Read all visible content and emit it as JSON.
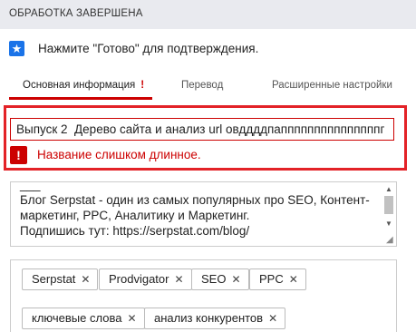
{
  "header": {
    "title": "ОБРАБОТКА ЗАВЕРШЕНА"
  },
  "notice": {
    "icon": "star-icon",
    "text": "Нажмите \"Готово\" для подтверждения."
  },
  "tabs": [
    {
      "label": "Основная информация",
      "badge": "!"
    },
    {
      "label": "Перевод"
    },
    {
      "label": "Расширенные настройки"
    }
  ],
  "title_field": {
    "value": "Выпуск 2  Дерево сайта и анализ url овддддпапппппппппппппппг"
  },
  "error": {
    "icon": "!",
    "message": "Название слишком длинное."
  },
  "description": {
    "text": "___\nБлог Serpstat - один из самых популярных про SEO, Контент-маркетинг, PPC, Аналитику и Маркетинг.\nПодпишись тут: https://serpstat.com/blog/"
  },
  "tags": [
    "Serpstat",
    "Prodvigator",
    "SEO",
    "PPC",
    "ключевые слова",
    "анализ конкурентов"
  ],
  "colors": {
    "accent_red": "#cc0000",
    "highlight_red": "#e32227",
    "star_blue": "#1a73e8"
  }
}
